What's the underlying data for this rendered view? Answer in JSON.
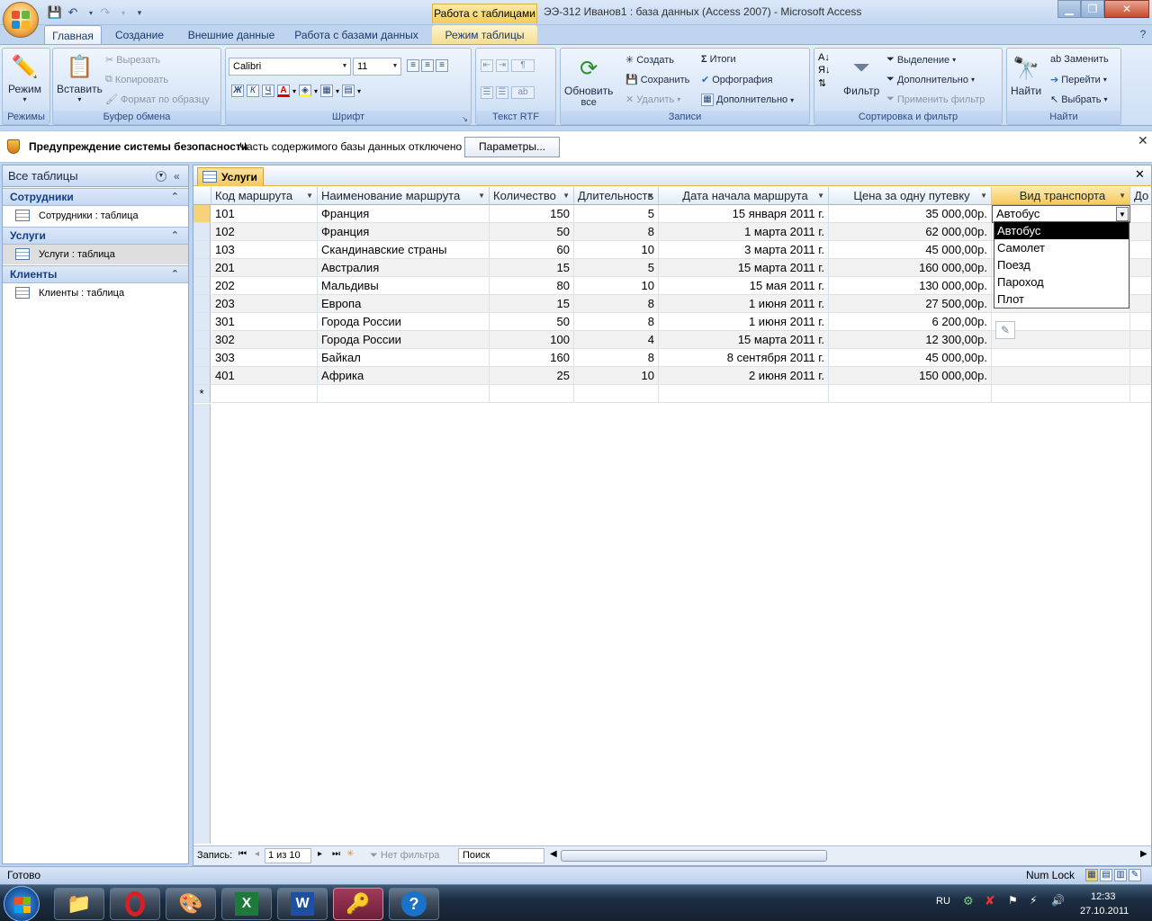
{
  "window": {
    "context_tab": "Работа с таблицами",
    "title": "ЭЭ-312 Иванов1 : база данных (Access 2007) - Microsoft Access"
  },
  "ribbon_tabs": [
    "Главная",
    "Создание",
    "Внешние данные",
    "Работа с базами данных",
    "Режим таблицы"
  ],
  "ribbon": {
    "modes": {
      "mode_label": "Режим",
      "group_label": "Режимы"
    },
    "clipboard": {
      "paste_label": "Вставить",
      "cut_label": "Вырезать",
      "copy_label": "Копировать",
      "format_painter_label": "Формат по образцу",
      "group_label": "Буфер обмена"
    },
    "font": {
      "font_name": "Calibri",
      "font_size": "11",
      "group_label": "Шрифт",
      "bold_label": "Ж",
      "italic_label": "К",
      "underline_label": "Ч",
      "font_color_label": "A"
    },
    "rtf": {
      "group_label": "Текст RTF"
    },
    "records": {
      "refresh_label": "Обновить",
      "refresh_label2": "все",
      "new_label": "Создать",
      "save_label": "Сохранить",
      "delete_label": "Удалить",
      "totals_label": "Итоги",
      "spelling_label": "Орфография",
      "more_label": "Дополнительно",
      "group_label": "Записи"
    },
    "sort": {
      "filter_label": "Фильтр",
      "selection_label": "Выделение",
      "advanced_label": "Дополнительно",
      "toggle_filter_label": "Применить фильтр",
      "group_label": "Сортировка и фильтр"
    },
    "find": {
      "find_label": "Найти",
      "replace_label": "Заменить",
      "goto_label": "Перейти",
      "select_label": "Выбрать",
      "group_label": "Найти"
    }
  },
  "security_bar": {
    "title": "Предупреждение системы безопасности",
    "message": "Часть содержимого базы данных отключено",
    "button": "Параметры..."
  },
  "nav_pane": {
    "header": "Все таблицы",
    "groups": [
      {
        "name": "Сотрудники",
        "item": "Сотрудники : таблица"
      },
      {
        "name": "Услуги",
        "item": "Услуги : таблица"
      },
      {
        "name": "Клиенты",
        "item": "Клиенты : таблица"
      }
    ]
  },
  "document": {
    "tab_title": "Услуги",
    "columns": [
      "Код маршрута",
      "Наименование маршрута",
      "Количество",
      "Длительность",
      "Дата начала маршрута",
      "Цена за одну путевку",
      "Вид транспорта",
      "До"
    ],
    "rows": [
      [
        "101",
        "Франция",
        "150",
        "5",
        "15 января 2011 г.",
        "35 000,00р.",
        "Автобус"
      ],
      [
        "102",
        "Франция",
        "50",
        "8",
        "1 марта 2011 г.",
        "62 000,00р.",
        ""
      ],
      [
        "103",
        "Скандинавские страны",
        "60",
        "10",
        "3 марта 2011 г.",
        "45 000,00р.",
        ""
      ],
      [
        "201",
        "Австралия",
        "15",
        "5",
        "15 марта 2011 г.",
        "160 000,00р.",
        ""
      ],
      [
        "202",
        "Мальдивы",
        "80",
        "10",
        "15 мая 2011 г.",
        "130 000,00р.",
        ""
      ],
      [
        "203",
        "Европа",
        "15",
        "8",
        "1 июня 2011 г.",
        "27 500,00р.",
        ""
      ],
      [
        "301",
        "Города России",
        "50",
        "8",
        "1 июня 2011 г.",
        "6 200,00р.",
        ""
      ],
      [
        "302",
        "Города России",
        "100",
        "4",
        "15 марта 2011 г.",
        "12 300,00р.",
        ""
      ],
      [
        "303",
        "Байкал",
        "160",
        "8",
        "8 сентября 2011 г.",
        "45 000,00р.",
        ""
      ],
      [
        "401",
        "Африка",
        "25",
        "10",
        "2 июня 2011 г.",
        "150 000,00р.",
        ""
      ]
    ],
    "new_row_marker": "*",
    "dropdown_options": [
      "Автобус",
      "Самолет",
      "Поезд",
      "Пароход",
      "Плот"
    ],
    "dropdown_selected": "Автобус"
  },
  "record_nav": {
    "label": "Запись:",
    "position": "1 из 10",
    "filter_label": "Нет фильтра",
    "search_placeholder": "Поиск"
  },
  "status": {
    "left": "Готово",
    "right": "Num Lock"
  },
  "taskbar": {
    "lang": "RU",
    "time": "12:33",
    "date": "27.10.2011"
  },
  "colors": {
    "accent_tab": "#f6c95d",
    "ribbon_bg": "#cddff5",
    "nav_group_text": "#153f86"
  }
}
